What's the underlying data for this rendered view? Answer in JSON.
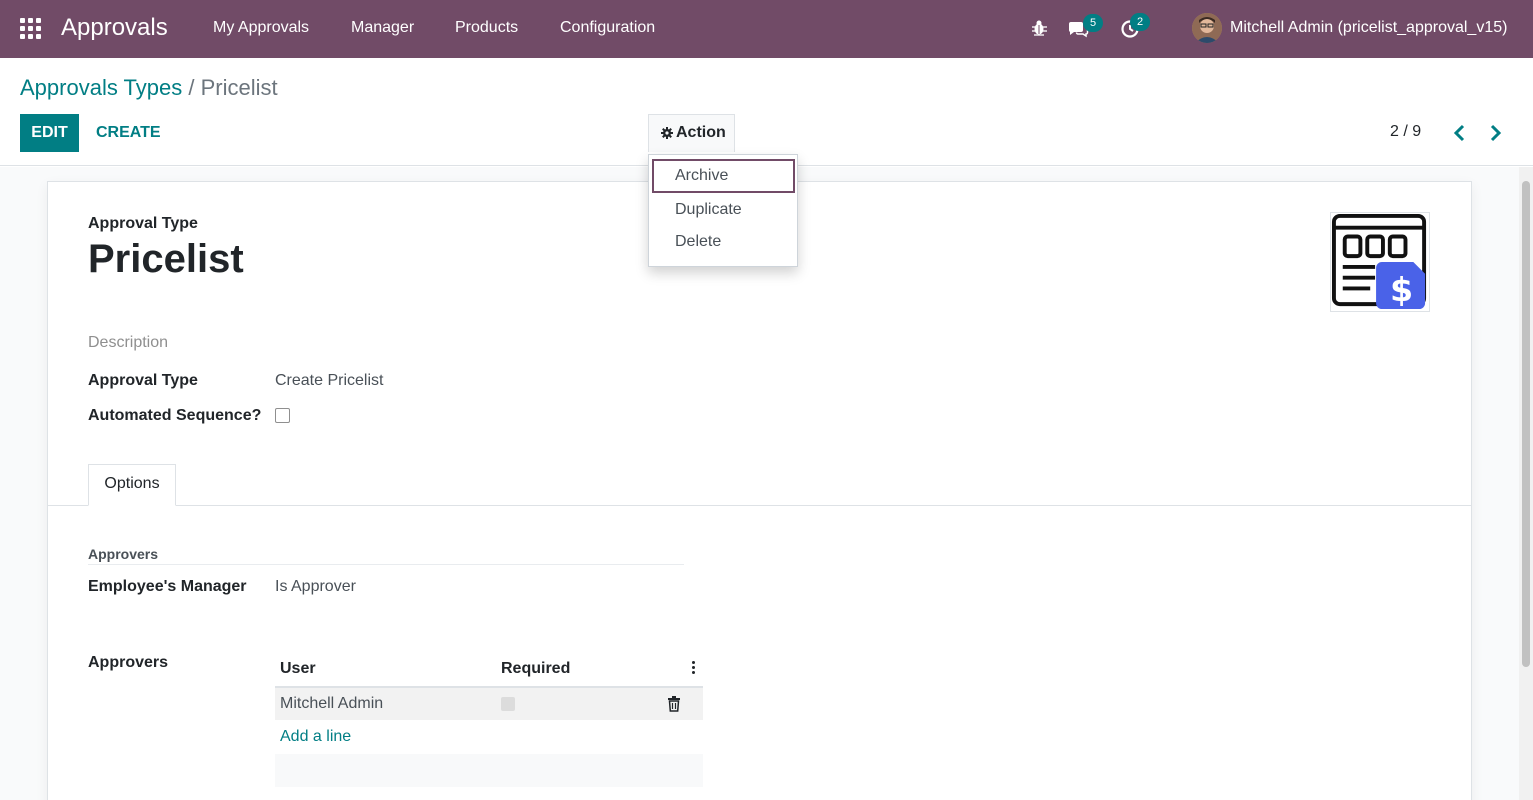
{
  "navbar": {
    "app_name": "Approvals",
    "menu": [
      "My Approvals",
      "Manager",
      "Products",
      "Configuration"
    ],
    "messages_count": "5",
    "activities_count": "2",
    "user_name": "Mitchell Admin (pricelist_approval_v15)",
    "icons": [
      "apps-icon",
      "bug-icon",
      "chat-icon",
      "clock-icon",
      "avatar"
    ],
    "color": "#714B67"
  },
  "control_panel": {
    "breadcrumb_parent": "Approvals Types",
    "breadcrumb_separator": "/",
    "breadcrumb_current": "Pricelist",
    "edit_label": "EDIT",
    "create_label": "CREATE",
    "action_label": "Action",
    "pager": "2 / 9",
    "accent": "#017E84"
  },
  "action_menu": {
    "items": [
      "Archive",
      "Duplicate",
      "Delete"
    ],
    "focused_item": "Archive"
  },
  "form": {
    "type_label": "Approval Type",
    "name": "Pricelist",
    "description_placeholder": "Description",
    "approval_type_label": "Approval Type",
    "approval_type_value": "Create Pricelist",
    "automated_sequence_label": "Automated Sequence?",
    "automated_sequence_checked": false,
    "tab_options": "Options",
    "approvers_group_title": "Approvers",
    "employee_manager_label": "Employee's Manager",
    "employee_manager_value": "Is Approver",
    "approvers_label": "Approvers",
    "approvers_table": {
      "columns": [
        "User",
        "Required"
      ],
      "rows": [
        {
          "user": "Mitchell Admin",
          "required": false
        }
      ],
      "add_line_label": "Add a line"
    }
  }
}
